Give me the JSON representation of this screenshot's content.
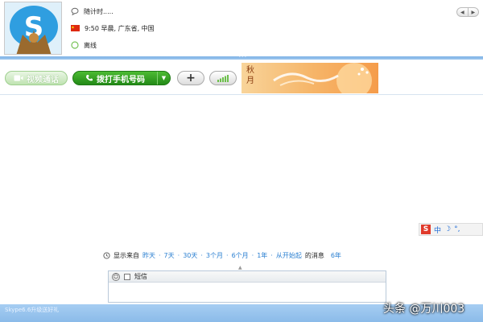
{
  "contact": {
    "mood_message": "随计时.....",
    "location": "9:50 早晨, 广东省, 中国",
    "status": "离线"
  },
  "toolbar": {
    "video_call_label": "视频通话",
    "phone_call_label": "拨打手机号码",
    "add_label": "+",
    "banner_text": "秋月"
  },
  "history": {
    "prefix": "显示来自",
    "options": [
      "昨天",
      "7天",
      "30天",
      "3个月",
      "6个月",
      "1年",
      "从开始起"
    ],
    "suffix": "的消息",
    "extra": "6年"
  },
  "ime": {
    "logo": "S",
    "mode": "中"
  },
  "compose": {
    "sms_label": "短信"
  },
  "status_bar": {
    "text": "Skype6.6升级送好礼"
  },
  "watermark": "头条 @万川003",
  "colors": {
    "accent_blue": "#2a7fd1",
    "call_green": "#238a17",
    "status_bar": "#8bbbe9"
  },
  "icons": {
    "mood": "speech-bubble-icon",
    "location": "china-flag-icon",
    "status": "offline-icon",
    "history": "clock-icon",
    "emoticon": "smiley-icon"
  }
}
